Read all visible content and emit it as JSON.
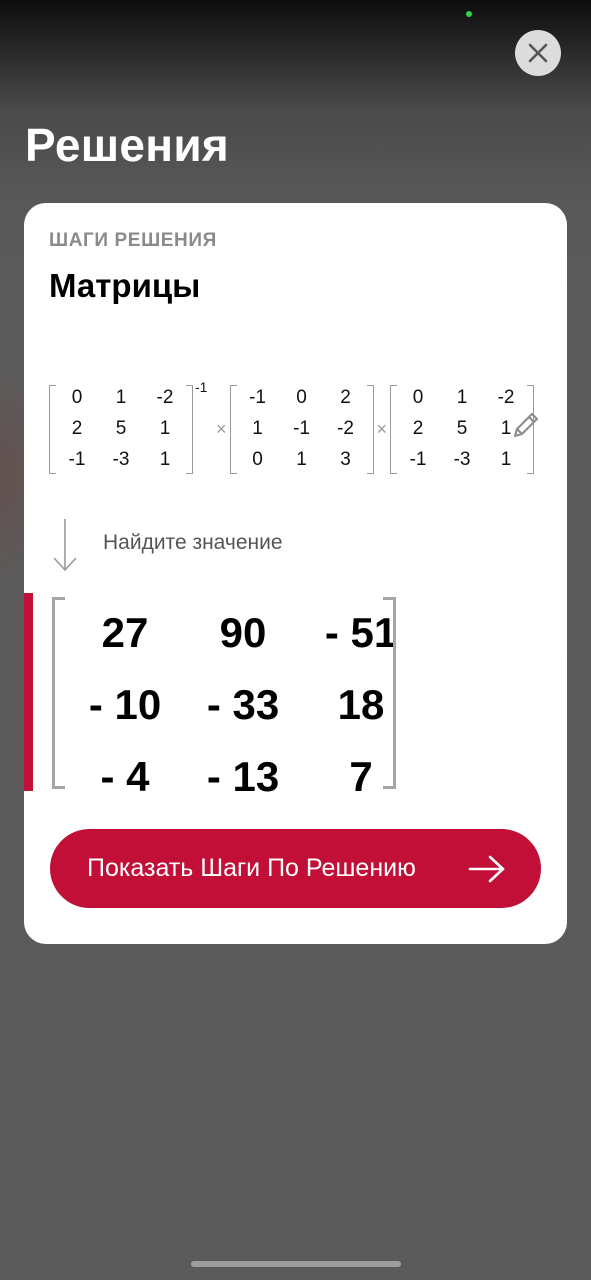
{
  "colors": {
    "accent": "#c20f37",
    "status_dot": "#2bd34a"
  },
  "icons": {
    "close": "close-icon",
    "edit": "pencil-icon",
    "down": "arrow-down-icon",
    "forward": "arrow-right-icon"
  },
  "header": {
    "title": "Решения"
  },
  "card": {
    "eyebrow": "ШАГИ РЕШЕНИЯ",
    "title": "Матрицы",
    "expression": {
      "matrices": [
        {
          "rows": [
            [
              "0",
              "1",
              "-2"
            ],
            [
              "2",
              "5",
              "1"
            ],
            [
              "-1",
              "-3",
              "1"
            ]
          ],
          "exponent": "-1"
        },
        {
          "rows": [
            [
              "-1",
              "0",
              "2"
            ],
            [
              "1",
              "-1",
              "-2"
            ],
            [
              "0",
              "1",
              "3"
            ]
          ],
          "exponent": ""
        },
        {
          "rows": [
            [
              "0",
              "1",
              "-2"
            ],
            [
              "2",
              "5",
              "1"
            ],
            [
              "-1",
              "-3",
              "1"
            ]
          ],
          "exponent": ""
        }
      ],
      "operator": "×"
    },
    "task_label": "Найдите значение",
    "result": [
      [
        "27",
        "90",
        "- 51"
      ],
      [
        "- 10",
        "- 33",
        "18"
      ],
      [
        "- 4",
        "- 13",
        "7"
      ]
    ],
    "cta_label": "Показать Шаги По Решению"
  }
}
